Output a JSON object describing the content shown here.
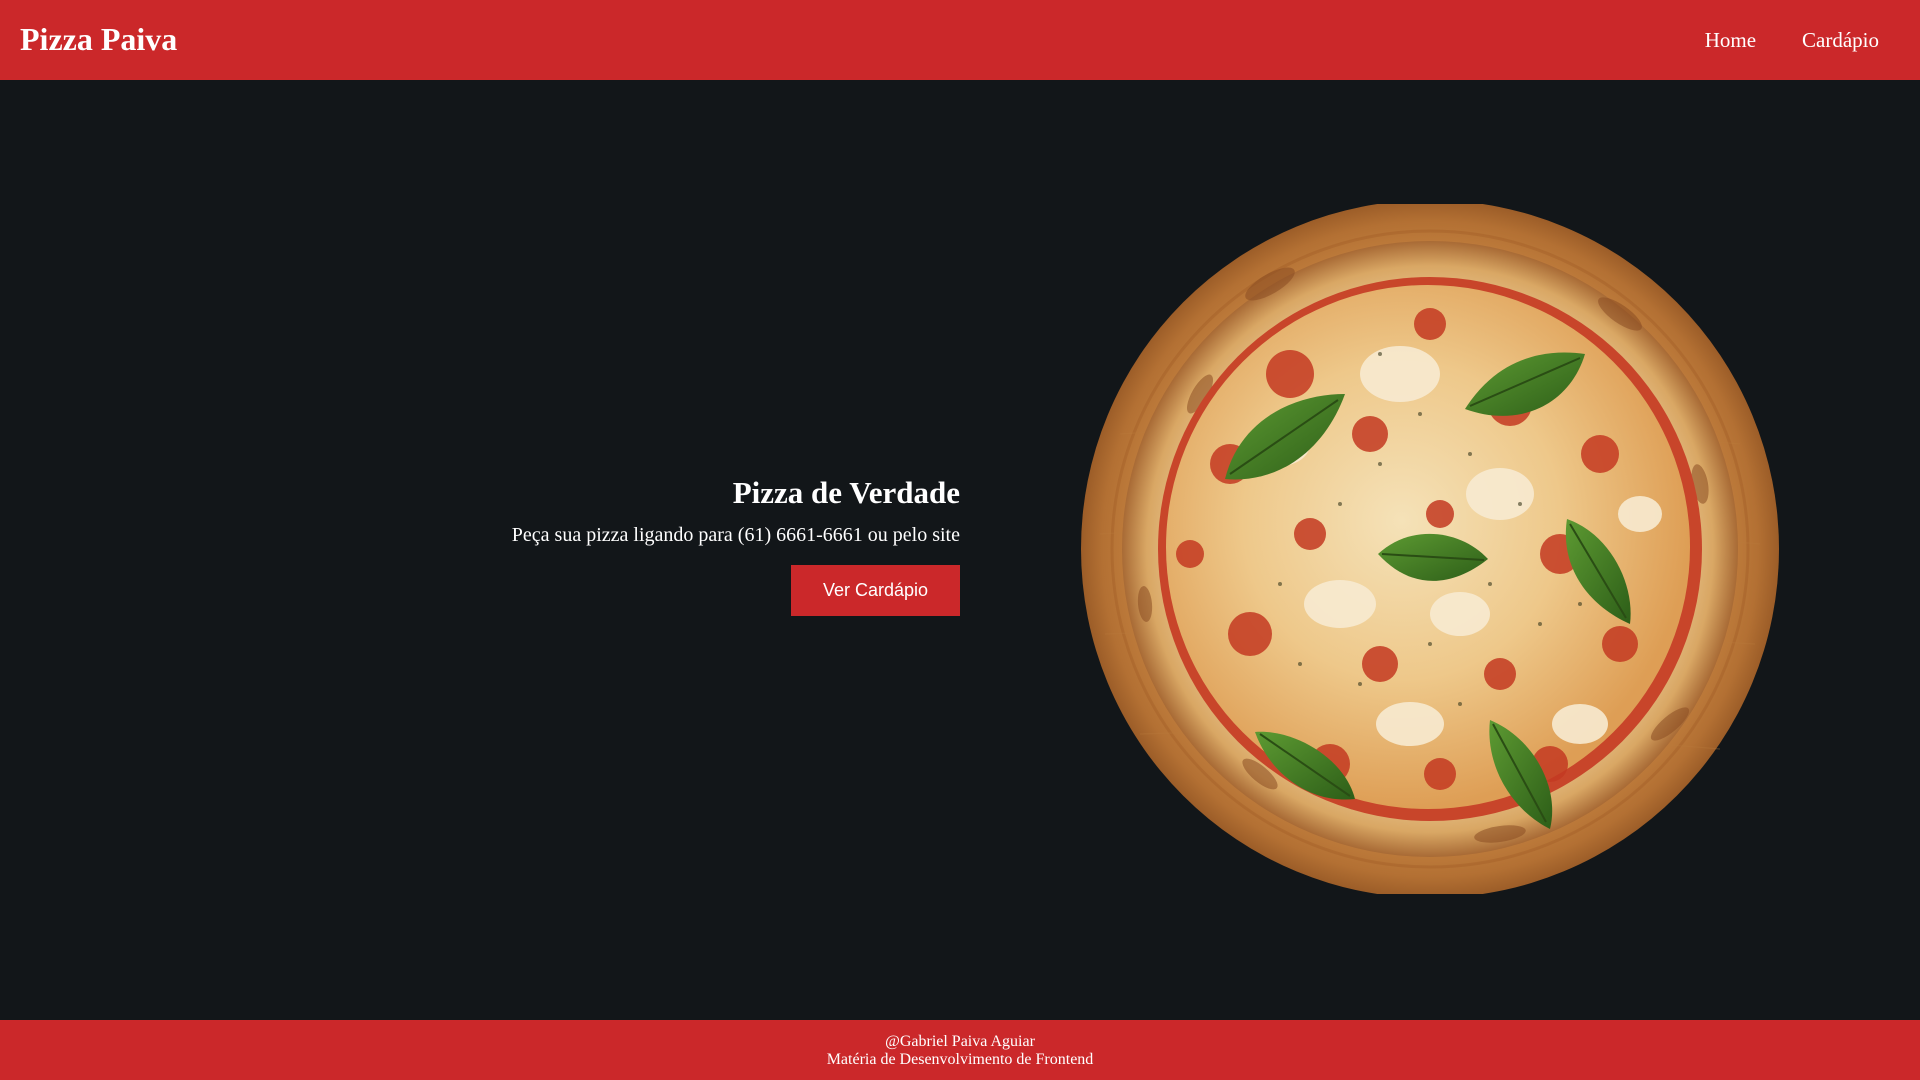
{
  "header": {
    "brand": "Pizza Paiva",
    "nav": [
      {
        "label": "Home"
      },
      {
        "label": "Cardápio"
      }
    ]
  },
  "hero": {
    "title": "Pizza de Verdade",
    "subtitle": "Peça sua pizza ligando para (61) 6661-6661 ou pelo site",
    "cta_label": "Ver Cardápio",
    "image_icon": "pizza-image"
  },
  "footer": {
    "author": "@Gabriel Paiva Aguiar",
    "course": "Matéria de Desenvolvimento de Frontend"
  },
  "colors": {
    "brand_red": "#cb282a",
    "background": "#121619",
    "text": "#ffffff"
  }
}
